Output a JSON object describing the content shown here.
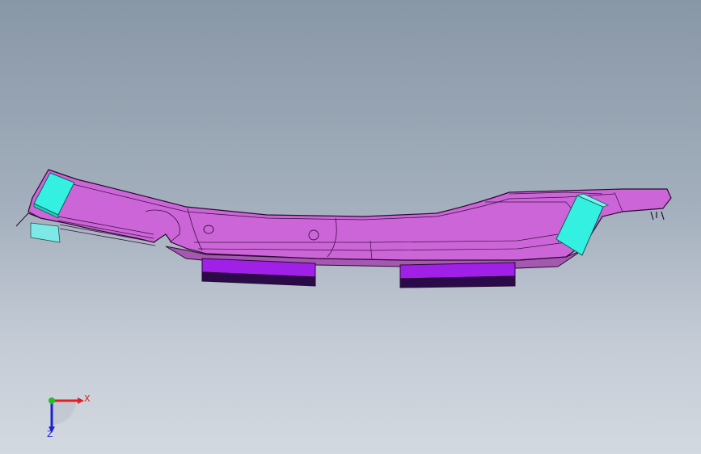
{
  "viewport": {
    "background_top": "#8897a6",
    "background_bottom": "#d3d9e0"
  },
  "model": {
    "body_color": "#cc66d8",
    "edge_color": "#2a0a30",
    "pad_color": "#a020e8",
    "pad_dark_color": "#2a0a48",
    "block_color": "#33f0e0"
  },
  "triad": {
    "x_label": "X",
    "z_label": "Z",
    "x_color": "#e02020",
    "y_color": "#20c020",
    "z_color": "#2020d0"
  }
}
